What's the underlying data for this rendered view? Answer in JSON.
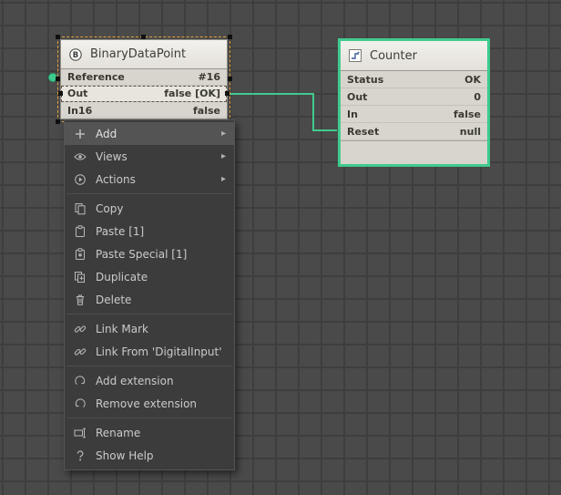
{
  "canvas": {
    "background": "#4a4a4a",
    "grid_line": "#3e3e3e"
  },
  "wire": {
    "color": "#3fcb8e"
  },
  "nodes": {
    "binary_data_point": {
      "title": "BinaryDataPoint",
      "selected": true,
      "selection_color": "#e2a23b",
      "rows": [
        {
          "label": "Reference",
          "value": "#16"
        },
        {
          "label": "Out",
          "value": "false [OK]",
          "selected": true
        },
        {
          "label": "In16",
          "value": "false"
        }
      ]
    },
    "counter": {
      "title": "Counter",
      "selected": true,
      "selection_color": "#3fcb8e",
      "rows": [
        {
          "label": "Status",
          "value": "OK"
        },
        {
          "label": "Out",
          "value": "0"
        },
        {
          "label": "In",
          "value": "false"
        },
        {
          "label": "Reset",
          "value": "null"
        }
      ]
    }
  },
  "context_menu": {
    "items": [
      {
        "label": "Add",
        "icon": "add-icon",
        "has_submenu": true,
        "highlighted": true
      },
      {
        "label": "Views",
        "icon": "views-icon",
        "has_submenu": true
      },
      {
        "label": "Actions",
        "icon": "actions-icon",
        "has_submenu": true
      },
      {
        "label": "Copy",
        "icon": "copy-icon"
      },
      {
        "label": "Paste [1]",
        "icon": "paste-icon"
      },
      {
        "label": "Paste Special [1]",
        "icon": "paste-special-icon"
      },
      {
        "label": "Duplicate",
        "icon": "duplicate-icon"
      },
      {
        "label": "Delete",
        "icon": "delete-icon"
      },
      {
        "label": "Link Mark",
        "icon": "link-icon"
      },
      {
        "label": "Link From 'DigitalInput'",
        "icon": "link-icon"
      },
      {
        "label": "Add extension",
        "icon": "add-extension-icon"
      },
      {
        "label": "Remove extension",
        "icon": "remove-extension-icon"
      },
      {
        "label": "Rename",
        "icon": "rename-icon"
      },
      {
        "label": "Show Help",
        "icon": "help-icon"
      }
    ],
    "submenu_arrow": "▸"
  }
}
